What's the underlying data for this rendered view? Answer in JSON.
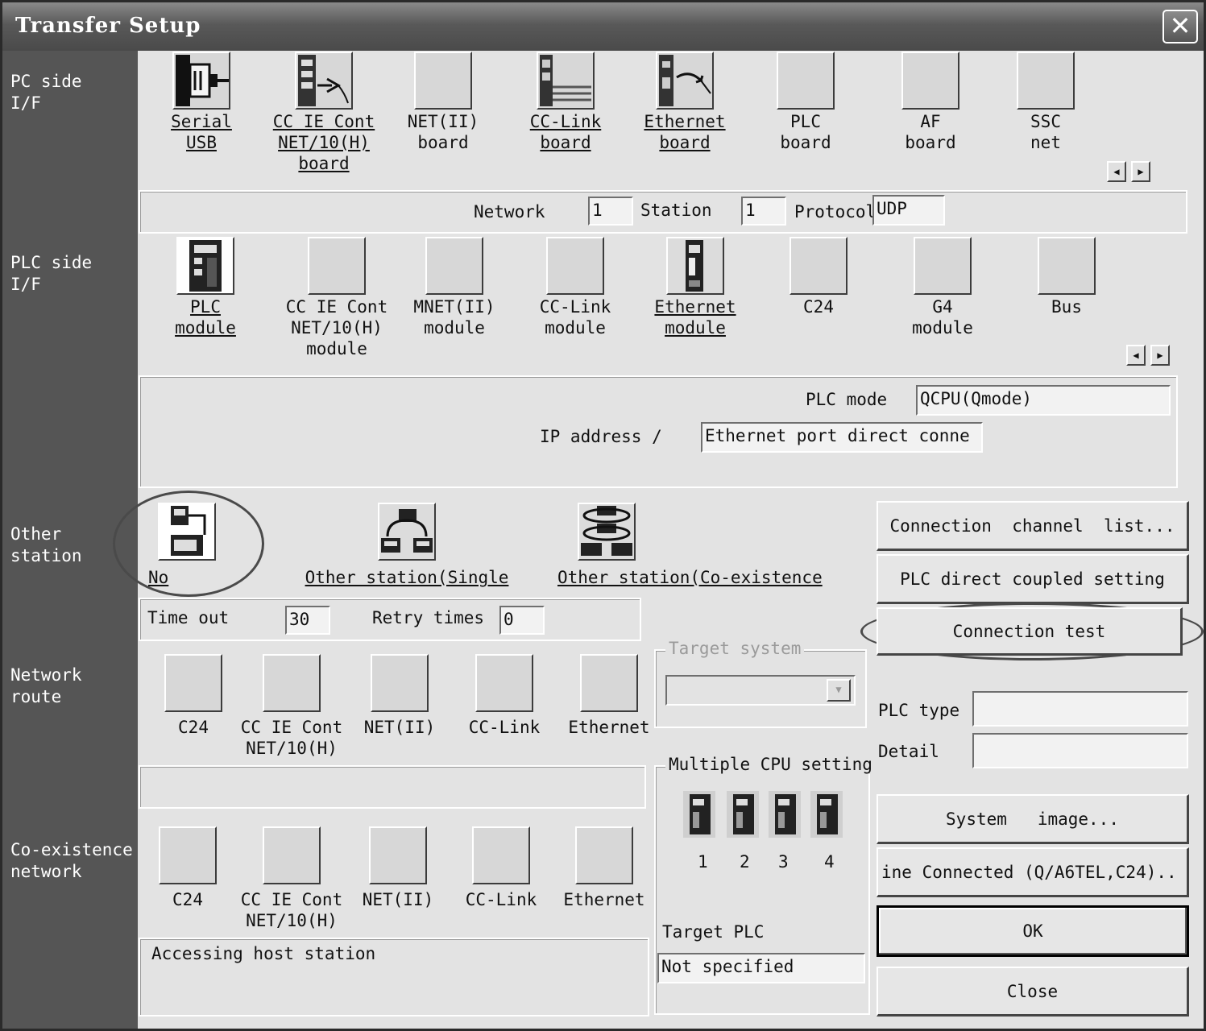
{
  "window": {
    "title": "Transfer Setup",
    "close_symbol": "✕"
  },
  "sections": {
    "pc_side": "PC side\nI/F",
    "plc_side": "PLC side\nI/F",
    "other_station": "Other\nstation",
    "network_route": "Network\nroute",
    "coexistence": "Co-existence\nnetwork"
  },
  "pc_side": {
    "items": [
      {
        "label": "Serial\nUSB",
        "icon": "serial-connector-icon"
      },
      {
        "label": "CC IE Cont\nNET/10(H)\nboard",
        "icon": "cc-ie-board-icon"
      },
      {
        "label": "NET(II)\nboard",
        "icon": "blank-icon"
      },
      {
        "label": "CC-Link\nboard",
        "icon": "cc-link-board-icon"
      },
      {
        "label": "Ethernet\nboard",
        "icon": "ethernet-board-icon"
      },
      {
        "label": "PLC\nboard",
        "icon": "blank-icon"
      },
      {
        "label": "AF\nboard",
        "icon": "blank-icon"
      },
      {
        "label": "SSC\nnet",
        "icon": "blank-icon"
      }
    ],
    "network_label": "Network",
    "network_value": "1",
    "station_label": "Station",
    "station_value": "1",
    "protocol_label": "Protocol",
    "protocol_value": "UDP"
  },
  "plc_side": {
    "items": [
      {
        "label": "PLC\nmodule",
        "icon": "plc-module-icon"
      },
      {
        "label": "CC IE Cont\nNET/10(H)\nmodule",
        "icon": "blank-icon"
      },
      {
        "label": "MNET(II)\nmodule",
        "icon": "blank-icon"
      },
      {
        "label": "CC-Link\nmodule",
        "icon": "blank-icon"
      },
      {
        "label": "Ethernet\nmodule",
        "icon": "ethernet-module-icon"
      },
      {
        "label": "C24",
        "icon": "blank-icon"
      },
      {
        "label": "G4\nmodule",
        "icon": "blank-icon"
      },
      {
        "label": "Bus",
        "icon": "blank-icon"
      }
    ],
    "plc_mode_label": "PLC mode",
    "plc_mode_value": "QCPU(Qmode)",
    "ip_label": "IP address /",
    "ip_value": "Ethernet port direct conne"
  },
  "other_station": {
    "options": [
      {
        "label": "No",
        "icon": "no-other-station-icon"
      },
      {
        "label": "Other station(Single",
        "icon": "single-network-icon"
      },
      {
        "label": "Other station(Co-existence",
        "icon": "coexistence-network-icon"
      }
    ],
    "timeout_label": "Time out",
    "timeout_value": "30",
    "retry_label": "Retry times",
    "retry_value": "0"
  },
  "network_route": {
    "items": [
      "C24",
      "CC IE Cont\nNET/10(H)",
      "NET(II)",
      "CC-Link",
      "Ethernet"
    ]
  },
  "coexistence": {
    "items": [
      "C24",
      "CC IE Cont\nNET/10(H)",
      "NET(II)",
      "CC-Link",
      "Ethernet"
    ],
    "status_text": "Accessing host station"
  },
  "target_system": {
    "title": "Target system",
    "value": ""
  },
  "multiple_cpu": {
    "title": "Multiple CPU setting",
    "cpus": [
      "1",
      "2",
      "3",
      "4"
    ]
  },
  "target_plc": {
    "label": "Target PLC",
    "value": "Not specified"
  },
  "right_panel": {
    "connection_channel_list": "Connection  channel  list...",
    "plc_direct_coupled": "PLC direct coupled setting",
    "connection_test": "Connection test",
    "plc_type_label": "PLC type",
    "plc_type_value": "",
    "detail_label": "Detail",
    "detail_value": "",
    "system_image": "System   image...",
    "line_connected": "ine Connected (Q/A6TEL,C24)..",
    "ok": "OK",
    "close": "Close"
  }
}
